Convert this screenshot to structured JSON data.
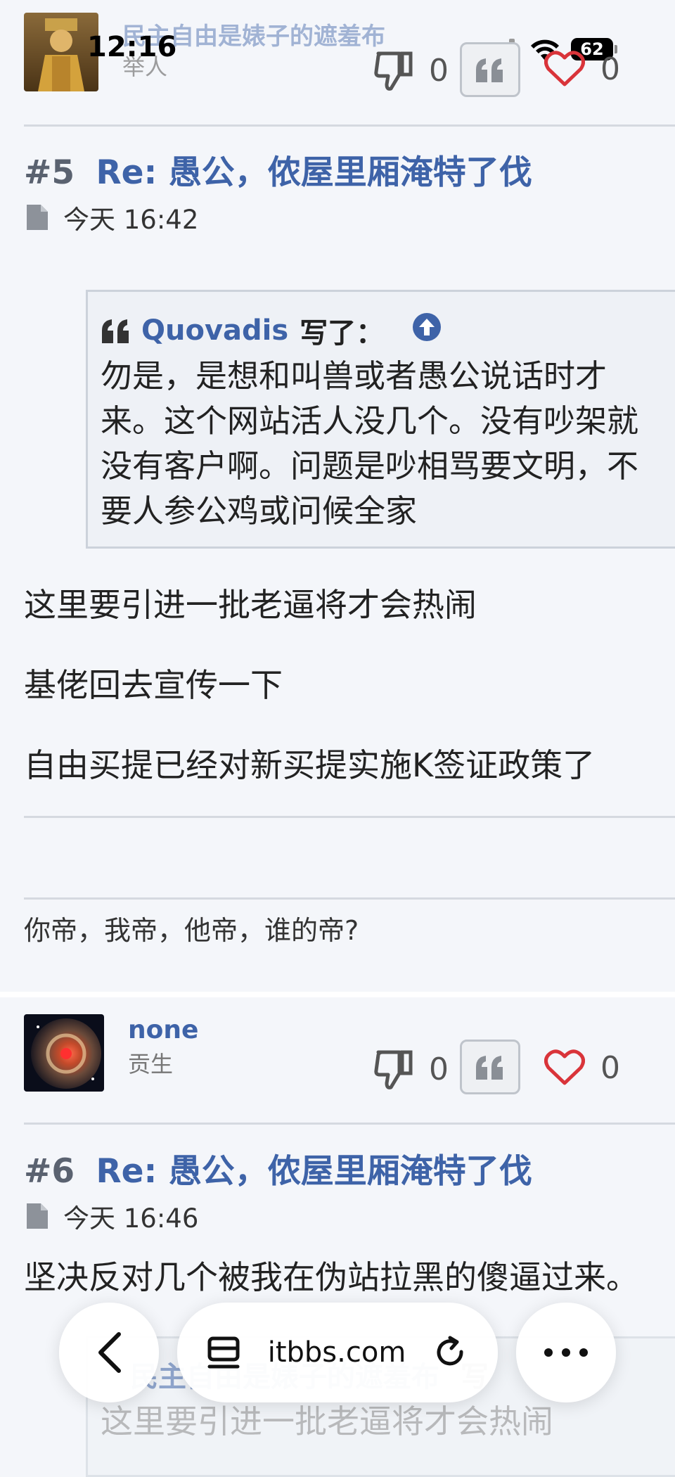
{
  "status_bar": {
    "time": "12:16",
    "battery": "62"
  },
  "post5": {
    "author_partial": "民主自由是婊子的遮羞布",
    "rank_partial": "举人",
    "dislike_count": "0",
    "like_count": "0",
    "number": "#5",
    "title": "Re: 愚公，侬屋里厢淹特了伐",
    "time": "今天 16:42",
    "quote": {
      "author": "Quovadis",
      "wrote": "写了：",
      "lines": [
        "勿是，是想和叫兽或者愚公说话时才",
        "来。这个网站活人没几个。没有吵架就",
        "没有客户啊。问题是吵相骂要文明，不",
        "要人参公鸡或问候全家"
      ]
    },
    "paragraphs": [
      "这里要引进一批老逼将才会热闹",
      "基佬回去宣传一下",
      "自由买提已经对新买提实施K签证政策了"
    ],
    "signature": "你帝，我帝，他帝，谁的帝?"
  },
  "post6": {
    "author": "none",
    "rank": "贡生",
    "dislike_count": "0",
    "like_count": "0",
    "number": "#6",
    "title": "Re: 愚公，侬屋里厢淹特了伐",
    "time": "今天 16:46",
    "paragraph": "坚决反对几个被我在伪站拉黑的傻逼过来。",
    "quote_partial": {
      "author": "民主自由是婊子的遮羞布",
      "wrote": "写",
      "line": "这里要引进一批老逼将才会热闹"
    }
  },
  "browser_bar": {
    "url": "itbbs.com"
  },
  "colors": {
    "link": "#3e63a8",
    "heart": "#d9343a",
    "page_bg": "#f4f6fa"
  }
}
